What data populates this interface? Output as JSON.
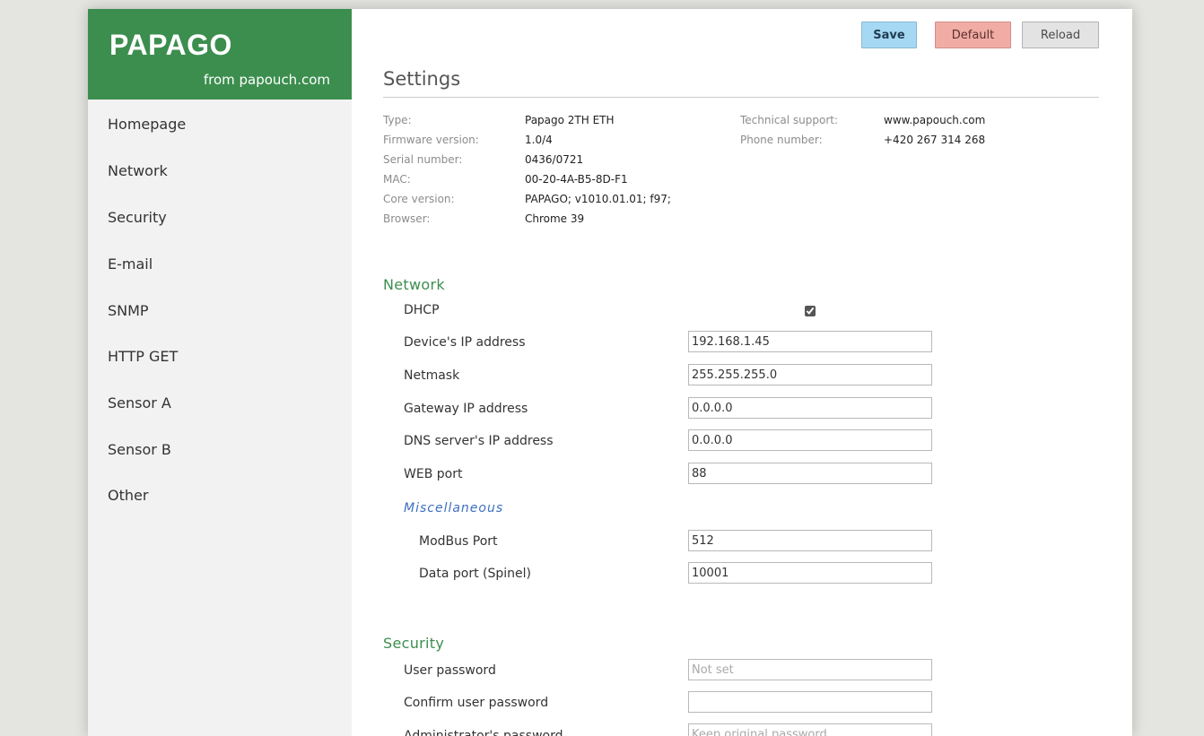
{
  "brand": {
    "title": "PAPAGO",
    "subtitle": "from papouch.com"
  },
  "nav": [
    {
      "label": "Homepage"
    },
    {
      "label": "Network"
    },
    {
      "label": "Security"
    },
    {
      "label": "E-mail"
    },
    {
      "label": "SNMP"
    },
    {
      "label": "HTTP GET"
    },
    {
      "label": "Sensor A"
    },
    {
      "label": "Sensor B"
    },
    {
      "label": "Other"
    }
  ],
  "toolbar": {
    "save_label": "Save",
    "default_label": "Default",
    "reload_label": "Reload"
  },
  "page": {
    "title": "Settings"
  },
  "info": {
    "left": [
      {
        "label": "Type:",
        "value": "Papago 2TH ETH"
      },
      {
        "label": "Firmware version:",
        "value": "1.0/4"
      },
      {
        "label": "Serial number:",
        "value": "0436/0721"
      },
      {
        "label": "MAC:",
        "value": "00-20-4A-B5-8D-F1"
      },
      {
        "label": "Core version:",
        "value": "PAPAGO; v1010.01.01; f97;"
      },
      {
        "label": "Browser:",
        "value": "Chrome 39"
      }
    ],
    "right": [
      {
        "label": "Technical support:",
        "value": "www.papouch.com"
      },
      {
        "label": "Phone number:",
        "value": "+420 267 314 268"
      }
    ]
  },
  "network": {
    "title": "Network",
    "dhcp_label": "DHCP",
    "dhcp_checked": true,
    "fields": [
      {
        "label": "Device's IP address",
        "value": "192.168.1.45"
      },
      {
        "label": "Netmask",
        "value": "255.255.255.0"
      },
      {
        "label": "Gateway IP address",
        "value": "0.0.0.0"
      },
      {
        "label": "DNS server's IP address",
        "value": "0.0.0.0"
      },
      {
        "label": "WEB port",
        "value": "88"
      }
    ],
    "misc_title": "Miscellaneous",
    "misc_fields": [
      {
        "label": "ModBus Port",
        "value": "512"
      },
      {
        "label": "Data port (Spinel)",
        "value": "10001"
      }
    ]
  },
  "security": {
    "title": "Security",
    "fields": [
      {
        "label": "User password",
        "value": "",
        "placeholder": "Not set"
      },
      {
        "label": "Confirm user password",
        "value": "",
        "placeholder": ""
      },
      {
        "label": "Administrator's password",
        "value": "",
        "placeholder": "Keep original password"
      }
    ]
  }
}
